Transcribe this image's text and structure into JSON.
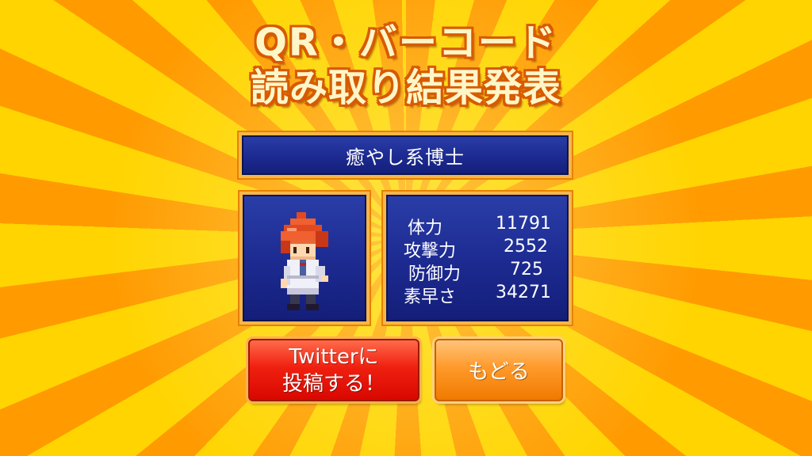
{
  "title": {
    "line1": "QR・バーコード",
    "line2": "読み取り結果発表"
  },
  "character": {
    "name": "癒やし系博士",
    "sprite": "pixel-doctor-character-red-hair-white-coat"
  },
  "stats": [
    {
      "label": "体力",
      "value": "11791"
    },
    {
      "label": "攻撃力",
      "value": "2552"
    },
    {
      "label": "防御力",
      "value": "725"
    },
    {
      "label": "素早さ",
      "value": "34271"
    }
  ],
  "buttons": {
    "twitter_line1": "Twitterに",
    "twitter_line2": "投稿する！",
    "back": "もどる"
  },
  "colors": {
    "panel_blue": "#1c2a90",
    "panel_border": "#f8b648",
    "twitter_red": "#f02010",
    "back_orange": "#ff9a2a",
    "background_rays": [
      "#ff9a00",
      "#ffd400"
    ]
  }
}
